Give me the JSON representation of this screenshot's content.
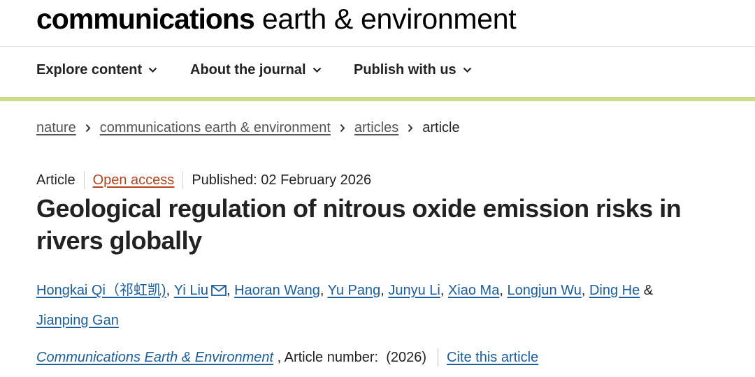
{
  "header": {
    "brand_bold": "communications",
    "brand_rest": " earth & environment"
  },
  "nav": {
    "items": [
      {
        "label": "Explore content",
        "icon": "chevron-down-icon"
      },
      {
        "label": "About the journal",
        "icon": "chevron-down-icon"
      },
      {
        "label": "Publish with us",
        "icon": "chevron-down-icon"
      }
    ]
  },
  "breadcrumb": {
    "items": [
      "nature",
      "communications earth & environment",
      "articles"
    ],
    "current": "article",
    "separator_icon": "chevron-right-icon"
  },
  "article": {
    "type": "Article",
    "access": "Open access",
    "published": "Published: 02 February 2026",
    "title": "Geological regulation of nitrous oxide emission risks in rivers globally",
    "authors": [
      "Hongkai Qi（祁虹凯)",
      "Yi Liu",
      "Haoran Wang",
      "Yu Pang",
      "Junyu Li",
      "Xiao Ma",
      "Longjun Wu",
      "Ding He",
      "Jianping Gan"
    ],
    "author_sep": ", ",
    "last_sep": " & ",
    "corresponding_icon": "mail-icon",
    "citation": {
      "journal": "Communications Earth & Environment",
      "article_number_label": " , Article number:  (2026)",
      "cite_label": "Cite this article"
    }
  },
  "colors": {
    "link": "#1a5ea0",
    "open_access": "#b2451e",
    "accent_bar": "#c9dc8a"
  }
}
